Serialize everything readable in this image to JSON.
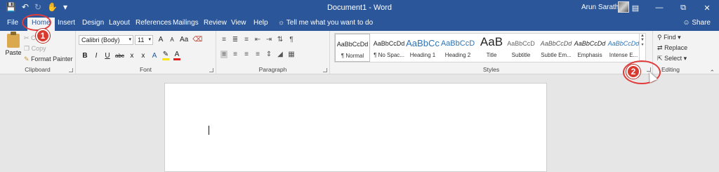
{
  "window": {
    "title": "Document1 - Word",
    "user_name": "Arun Sarathy",
    "qat_icons": [
      "save-icon",
      "undo-icon",
      "redo-icon",
      "touch-mode-icon",
      "customize-qat-icon"
    ],
    "controls": [
      "ribbon-display-icon",
      "minimize-icon",
      "restore-icon",
      "close-icon"
    ]
  },
  "tabs": [
    "File",
    "Home",
    "Insert",
    "Design",
    "Layout",
    "References",
    "Mailings",
    "Review",
    "View",
    "Help"
  ],
  "tell_me": "Tell me what you want to do",
  "share": "Share",
  "clipboard": {
    "label": "Clipboard",
    "paste": "Paste",
    "cut": "Cut",
    "copy": "Copy",
    "format_painter": "Format Painter"
  },
  "font": {
    "label": "Font",
    "family": "Calibri (Body)",
    "size": "11",
    "row1_glyphs": [
      "A",
      "A",
      "Aa"
    ],
    "row2_glyphs": [
      "B",
      "I",
      "U",
      "abc",
      "x",
      "x",
      "A",
      "A"
    ]
  },
  "paragraph": {
    "label": "Paragraph"
  },
  "styles": {
    "label": "Styles",
    "items": [
      {
        "sample": "AaBbCcDd",
        "name": "¶ Normal"
      },
      {
        "sample": "AaBbCcDd",
        "name": "¶ No Spac..."
      },
      {
        "sample": "AaBbCc",
        "name": "Heading 1"
      },
      {
        "sample": "AaBbCcD",
        "name": "Heading 2"
      },
      {
        "sample": "AaB",
        "name": "Title"
      },
      {
        "sample": "AaBbCcD",
        "name": "Subtitle"
      },
      {
        "sample": "AaBbCcDd",
        "name": "Subtle Em..."
      },
      {
        "sample": "AaBbCcDd",
        "name": "Emphasis"
      },
      {
        "sample": "AaBbCcDd",
        "name": "Intense E..."
      }
    ]
  },
  "editing": {
    "label": "Editing",
    "find": "Find",
    "replace": "Replace",
    "select": "Select"
  },
  "callouts": {
    "one": "1",
    "two": "2"
  },
  "colors": {
    "brand": "#2b579a",
    "callout": "#d83a2f"
  }
}
